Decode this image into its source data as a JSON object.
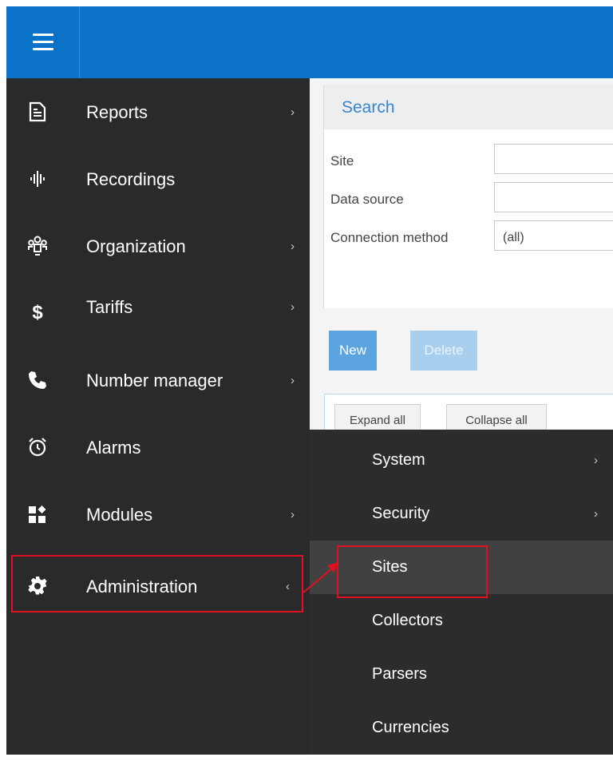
{
  "nav": {
    "items": [
      {
        "label": "Reports",
        "icon": "document-icon",
        "chevron": "›"
      },
      {
        "label": "Recordings",
        "icon": "waveform-icon",
        "chevron": ""
      },
      {
        "label": "Organization",
        "icon": "organization-icon",
        "chevron": "›"
      },
      {
        "label": "Tariffs",
        "icon": "dollar-icon",
        "chevron": "›"
      },
      {
        "label": "Number manager",
        "icon": "phone-icon",
        "chevron": "›"
      },
      {
        "label": "Alarms",
        "icon": "alarm-clock-icon",
        "chevron": ""
      },
      {
        "label": "Modules",
        "icon": "modules-icon",
        "chevron": "›"
      },
      {
        "label": "Administration",
        "icon": "gear-icon",
        "chevron": "‹"
      }
    ]
  },
  "search": {
    "title": "Search",
    "site_label": "Site",
    "site_value": "",
    "data_source_label": "Data source",
    "data_source_value": "",
    "connection_method_label": "Connection method",
    "connection_method_value": "(all)"
  },
  "actions": {
    "new_label": "New",
    "delete_label": "Delete"
  },
  "tree": {
    "expand_label": "Expand all",
    "collapse_label": "Collapse all"
  },
  "submenu": {
    "items": [
      {
        "label": "System",
        "chevron": "›"
      },
      {
        "label": "Security",
        "chevron": "›"
      },
      {
        "label": "Sites",
        "chevron": ""
      },
      {
        "label": "Collectors",
        "chevron": ""
      },
      {
        "label": "Parsers",
        "chevron": ""
      },
      {
        "label": "Currencies",
        "chevron": ""
      }
    ]
  },
  "colors": {
    "topbar": "#0a72c8",
    "sidebar": "#2a2a2a",
    "highlight": "#e01020",
    "accent": "#3386cf"
  }
}
